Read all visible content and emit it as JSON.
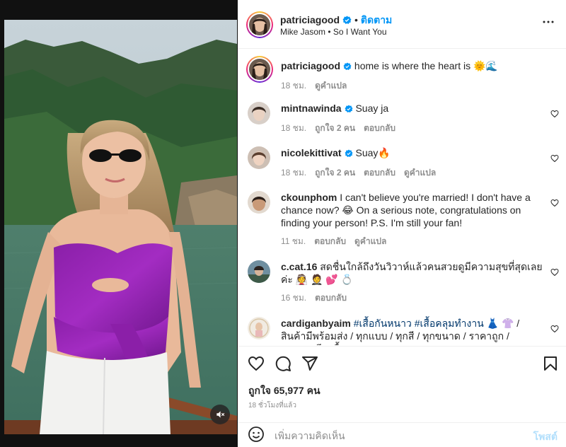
{
  "post": {
    "author": "patriciagood",
    "follow_label": "ติดตาม",
    "separator": "•",
    "audio_artist": "Mike Jasom",
    "audio_song": "So I Want You",
    "audio_separator": "•",
    "caption_text": "home is where the heart is",
    "caption_emoji": "🌞🌊",
    "caption_time": "18 ชม.",
    "caption_translate": "ดูคำแปล"
  },
  "comments": [
    {
      "user": "mintnawinda",
      "verified": true,
      "text": "Suay ja",
      "time": "18 ชม.",
      "likes": "ถูกใจ 2 คน",
      "reply": "ตอบกลับ",
      "translate": ""
    },
    {
      "user": "nicolekittivat",
      "verified": true,
      "text": "Suay🔥",
      "time": "18 ชม.",
      "likes": "ถูกใจ 2 คน",
      "reply": "ตอบกลับ",
      "translate": "ดูคำแปล"
    },
    {
      "user": "ckounphom",
      "verified": false,
      "text": "I can't believe you're married! I don't have a chance now? 😂 On a serious note, congratulations on finding your person! P.S. I'm still your fan!",
      "time": "11 ชม.",
      "likes": "",
      "reply": "ตอบกลับ",
      "translate": "ดูคำแปล"
    },
    {
      "user": "c.cat.16",
      "verified": false,
      "text": "สดชื่นใกล้ถึงวันวิวาห์แล้วคนสวยดูมีความสุขที่สุดเลยค่ะ 👰 🤵 💕 💍",
      "time": "16 ชม.",
      "likes": "",
      "reply": "ตอบกลับ",
      "translate": ""
    },
    {
      "user": "cardiganbyaim",
      "verified": false,
      "hashtag1": "#เสื้อกันหนาว",
      "hashtag2": "#เสื้อคลุมทำงาน",
      "text": "👗 👚 / สินค้ามีพร้อมส่ง / ทุกแบบ / ทุกสี / ทุกขนาด / ราคาถูก / คุณภาพดี / เสื้อ",
      "time": "",
      "likes": "",
      "reply": "",
      "translate": ""
    }
  ],
  "actions": {
    "like_icon": "heart-icon",
    "comment_icon": "comment-icon",
    "share_icon": "share-icon",
    "save_icon": "bookmark-icon",
    "likes_count": "ถูกใจ 65,977 คน",
    "time_ago": "18 ชั่วโมงที่แล้ว"
  },
  "composer": {
    "placeholder": "เพิ่มความคิดเห็น",
    "post_label": "โพสต์"
  },
  "colors": {
    "accent": "#0095f6",
    "verified": "#0095f6",
    "muted": "#8e8e8e",
    "post_disabled": "#b2dffc"
  }
}
